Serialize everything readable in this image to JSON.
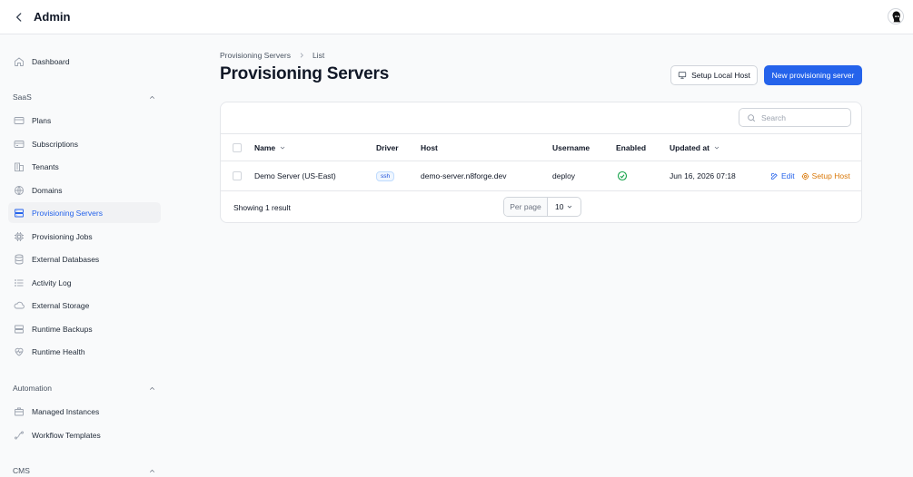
{
  "app": {
    "title": "Admin"
  },
  "sidebar": {
    "dashboard": "Dashboard",
    "groups": [
      {
        "label": "SaaS",
        "items": [
          "Plans",
          "Subscriptions",
          "Tenants",
          "Domains",
          "Provisioning Servers",
          "Provisioning Jobs",
          "External Databases",
          "Activity Log",
          "External Storage",
          "Runtime Backups",
          "Runtime Health"
        ]
      },
      {
        "label": "Automation",
        "items": [
          "Managed Instances",
          "Workflow Templates"
        ]
      },
      {
        "label": "CMS",
        "items": []
      }
    ],
    "active": "Provisioning Servers"
  },
  "breadcrumb": [
    "Provisioning Servers",
    "List"
  ],
  "page": {
    "title": "Provisioning Servers",
    "setup_local_host": "Setup Local Host",
    "new_button": "New provisioning server"
  },
  "table": {
    "search_placeholder": "Search",
    "columns": [
      "Name",
      "Driver",
      "Host",
      "Username",
      "Enabled",
      "Updated at"
    ],
    "rows": [
      {
        "name": "Demo Server (US-East)",
        "driver": "ssh",
        "host": "demo-server.n8forge.dev",
        "username": "deploy",
        "enabled": true,
        "updated_at": "Jun 16, 2026 07:18",
        "edit": "Edit",
        "setup": "Setup Host"
      }
    ],
    "showing": "Showing 1 result",
    "per_page_label": "Per page",
    "per_page_value": "10"
  },
  "colors": {
    "primary": "#2563eb",
    "success": "#16a34a",
    "warning": "#d97706"
  }
}
